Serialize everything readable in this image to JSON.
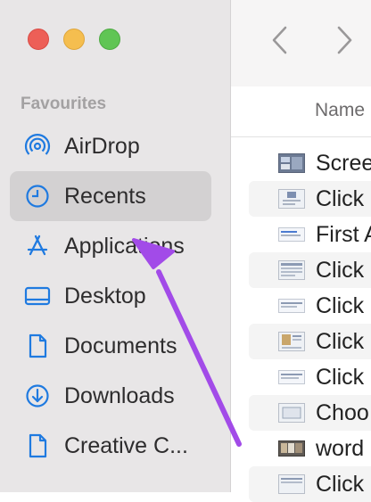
{
  "window": {
    "traffic_lights": [
      "close",
      "minimize",
      "zoom"
    ]
  },
  "sidebar": {
    "section_title": "Favourites",
    "items": [
      {
        "label": "AirDrop",
        "icon": "airdrop-icon",
        "selected": false
      },
      {
        "label": "Recents",
        "icon": "clock-icon",
        "selected": true
      },
      {
        "label": "Applications",
        "icon": "applications-icon",
        "selected": false
      },
      {
        "label": "Desktop",
        "icon": "desktop-icon",
        "selected": false
      },
      {
        "label": "Documents",
        "icon": "document-icon",
        "selected": false
      },
      {
        "label": "Downloads",
        "icon": "download-icon",
        "selected": false
      },
      {
        "label": "Creative C...",
        "icon": "file-icon",
        "selected": false
      }
    ]
  },
  "toolbar": {
    "back_icon": "chevron-left-icon",
    "forward_icon": "chevron-right-icon"
  },
  "list": {
    "column_name": "Name",
    "files": [
      {
        "name": "Scree",
        "thumb": "screenshot-thumbnail"
      },
      {
        "name": "Click",
        "thumb": "screenshot-thumbnail"
      },
      {
        "name": "First A",
        "thumb": "screenshot-thumbnail"
      },
      {
        "name": "Click",
        "thumb": "screenshot-thumbnail"
      },
      {
        "name": "Click",
        "thumb": "screenshot-thumbnail"
      },
      {
        "name": "Click",
        "thumb": "screenshot-thumbnail"
      },
      {
        "name": "Click",
        "thumb": "screenshot-thumbnail"
      },
      {
        "name": "Choo",
        "thumb": "screenshot-thumbnail"
      },
      {
        "name": "word",
        "thumb": "image-thumbnail"
      },
      {
        "name": "Click",
        "thumb": "screenshot-thumbnail"
      }
    ]
  },
  "colors": {
    "accent": "#1f7ae0",
    "annotation_arrow": "#a24be8",
    "sidebar_bg": "#e8e6e7",
    "selected_bg": "#d3d1d2"
  }
}
